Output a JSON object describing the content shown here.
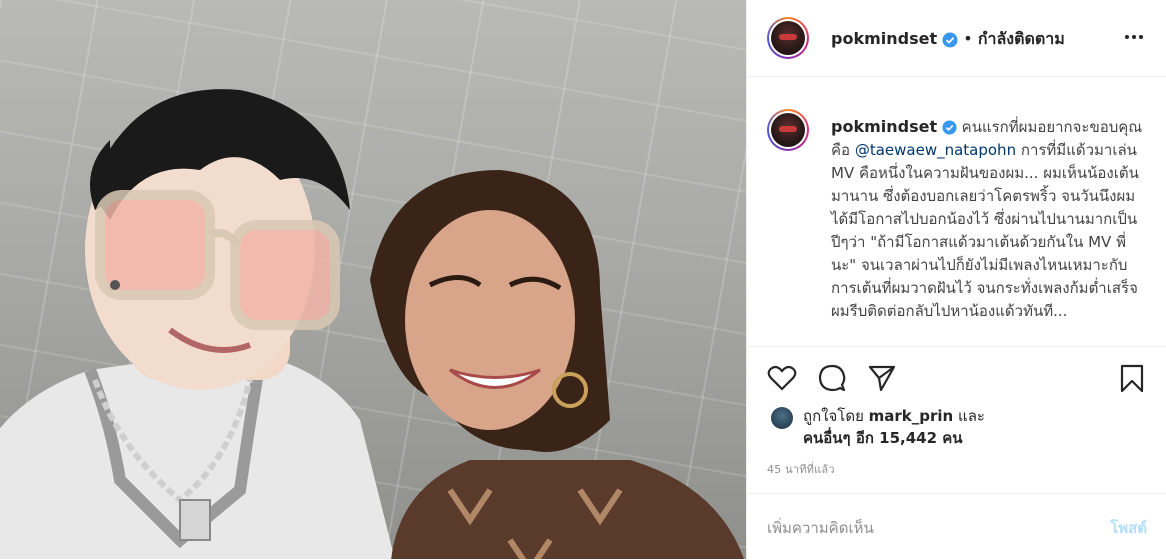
{
  "post": {
    "username": "pokmindset",
    "follow_separator": "•",
    "follow_status": "กำลังติดตาม",
    "more_icon": "more-horizontal-icon",
    "caption": {
      "username": "pokmindset",
      "text_before_mention": "คนแรกที่ผมอยากจะขอบคุณคือ",
      "mention": "@taewaew_natapohn",
      "text_after_mention": "การที่มีแด้วมาเล่น MV คือหนึ่งในความฝันของผม... ผมเห็นน้องเต้นมานาน ซึ่งต้องบอกเลยว่าโคตรพริ้ว จนวันนึงผมได้มีโอกาสไปบอกน้องไว้ ซึ่งผ่านไปนานมากเป็นปีๆว่า \"ถ้ามีโอกาสแด้วมาเต้นด้วยกันใน MV พี่นะ\" จนเวลาผ่านไปก็ยังไม่มีเพลงไหนเหมาะกับการเต้นที่ผมวาดฝันไว้ จนกระทั่งเพลงก้มต่ำเสร็จ ผมรีบติดต่อกลับไปหาน้องแด้วทันที..."
    },
    "actions": [
      "heart-icon",
      "comment-icon",
      "share-icon",
      "bookmark-icon"
    ],
    "likes": {
      "prefix": "ถูกใจโดย",
      "liker": "mark_prin",
      "and": "และ",
      "others_label": "คนอื่นๆ อีก 15,442 คน"
    },
    "timestamp": "45 นาทีที่แล้ว",
    "comment": {
      "placeholder": "เพิ่มความคิดเห็น",
      "post_label": "โพสต์"
    }
  },
  "colors": {
    "verified": "#3897f0",
    "mention": "#00376b",
    "post_disabled": "#b2dffc",
    "meta": "#8e8e8e"
  }
}
